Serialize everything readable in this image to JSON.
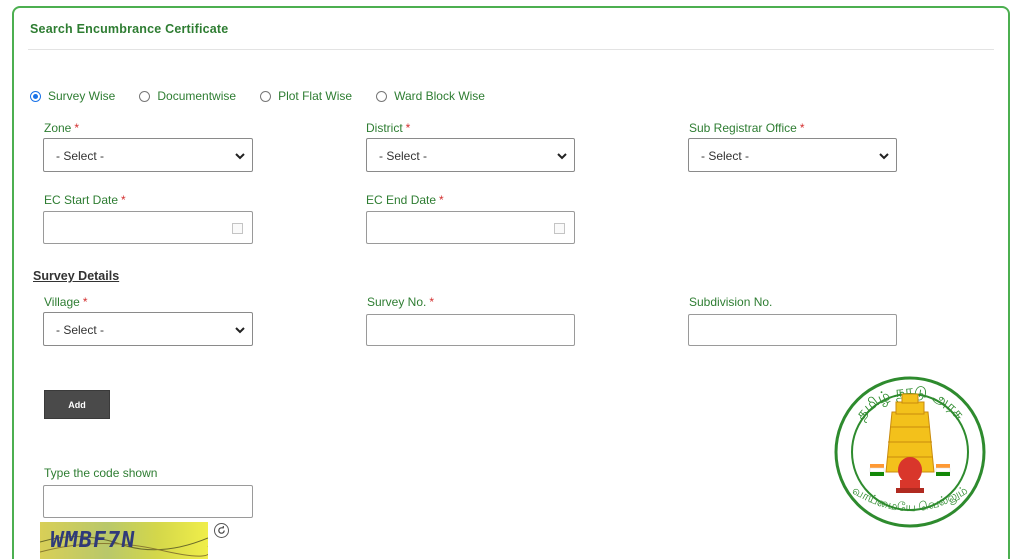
{
  "panel": {
    "title": "Search Encumbrance Certificate"
  },
  "search_type": {
    "options": [
      {
        "label": "Survey Wise",
        "checked": true
      },
      {
        "label": "Documentwise",
        "checked": false
      },
      {
        "label": "Plot Flat Wise",
        "checked": false
      },
      {
        "label": "Ward Block Wise",
        "checked": false
      }
    ]
  },
  "form": {
    "zone": {
      "label": "Zone",
      "required": "*",
      "value": "- Select -"
    },
    "district": {
      "label": "District",
      "required": "*",
      "value": "- Select -"
    },
    "sub_registrar": {
      "label": "Sub Registrar Office",
      "required": "*",
      "value": "- Select -"
    },
    "ec_start": {
      "label": "EC Start Date",
      "required": "*",
      "value": ""
    },
    "ec_end": {
      "label": "EC End Date",
      "required": "*",
      "value": ""
    }
  },
  "survey": {
    "heading": "Survey Details",
    "village": {
      "label": "Village",
      "required": "*",
      "value": "- Select -"
    },
    "survey_no": {
      "label": "Survey No.",
      "required": "*",
      "value": ""
    },
    "subdivision": {
      "label": "Subdivision No.",
      "value": ""
    },
    "add_label": "Add"
  },
  "captcha": {
    "label": "Type the code shown",
    "value": "",
    "image_text": "WMBF7N"
  },
  "emblem": {
    "top_text": "தமிழ் நாடு அரசு",
    "bottom_text": "வாய்மையே வெல்லும்"
  },
  "colors": {
    "accent": "#2e7d32",
    "border": "#4caf50",
    "required": "#d32f2f",
    "button": "#4a4a4a"
  }
}
